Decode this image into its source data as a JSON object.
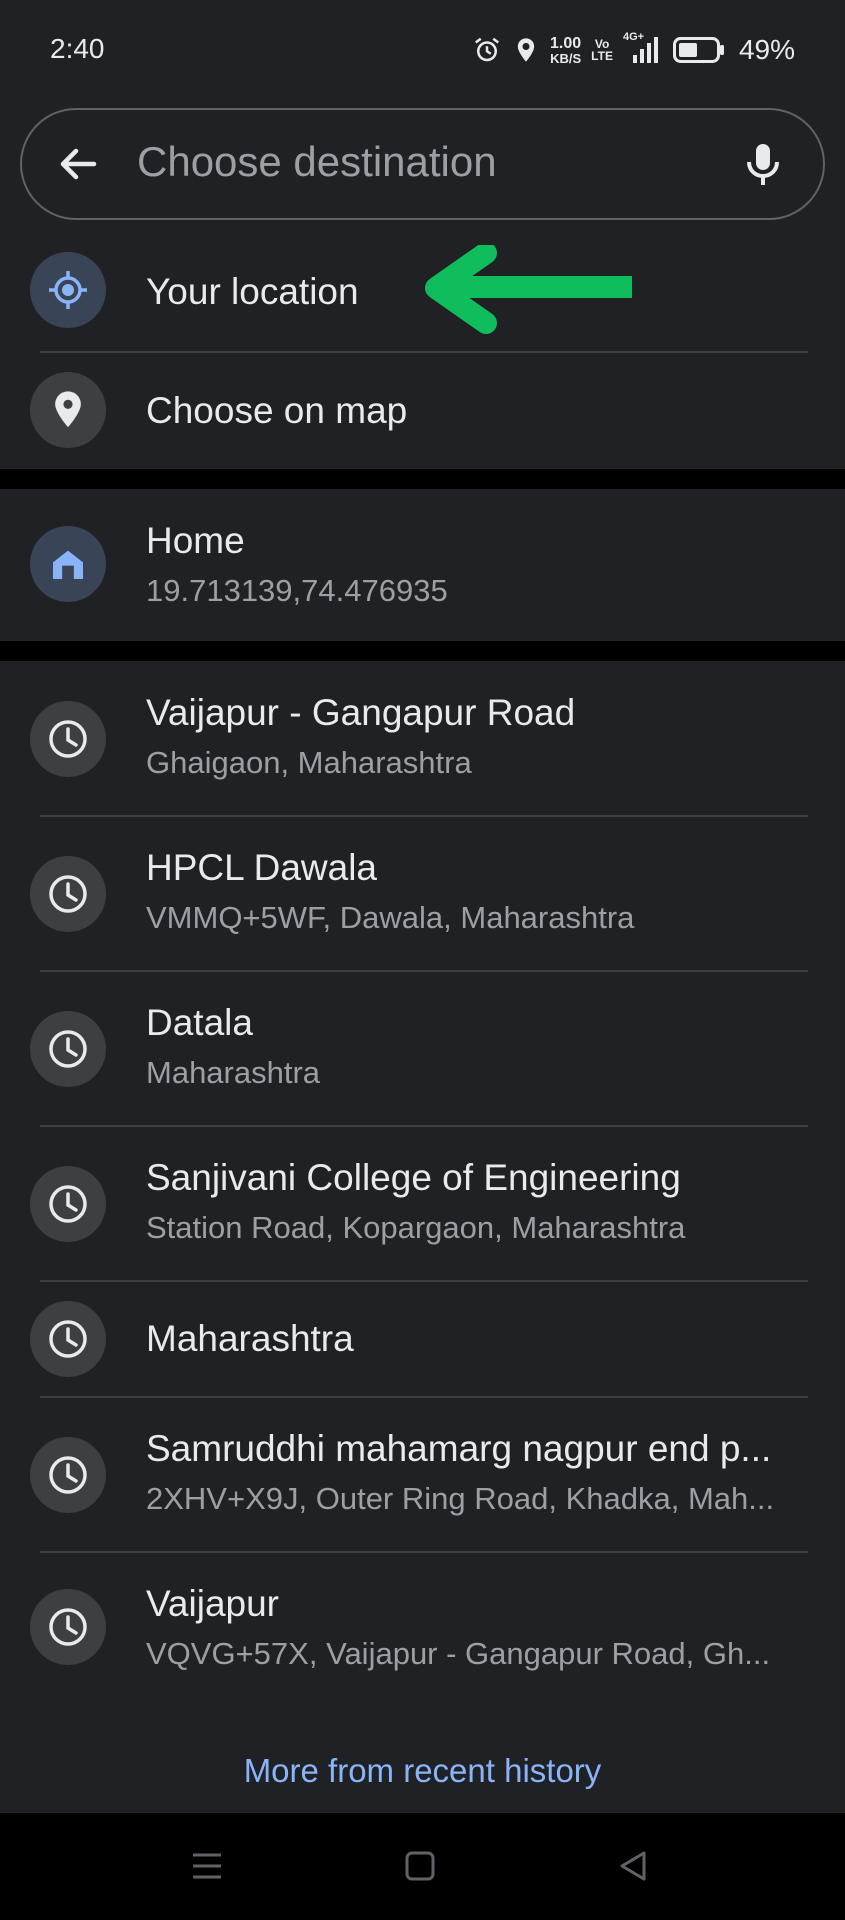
{
  "status_bar": {
    "time": "2:40",
    "net_speed_value": "1.00",
    "net_speed_unit": "KB/S",
    "volte_top": "Vo",
    "volte_bottom": "LTE",
    "network": "4G+",
    "battery": "49%",
    "icons": [
      "alarm-icon",
      "location-icon",
      "signal-icon",
      "battery-icon"
    ]
  },
  "search": {
    "placeholder": "Choose destination",
    "back_icon": "arrow-left-icon",
    "mic_icon": "microphone-icon"
  },
  "quick_options": [
    {
      "label": "Your location",
      "icon": "my-location-icon"
    },
    {
      "label": "Choose on map",
      "icon": "map-pin-icon"
    }
  ],
  "annotation": {
    "arrow_color": "#0fbd5c",
    "direction": "left"
  },
  "saved": {
    "home": {
      "label": "Home",
      "value": "19.713139,74.476935",
      "icon": "home-icon"
    }
  },
  "history": [
    {
      "title": "Vaijapur - Gangapur Road",
      "subtitle": "Ghaigaon, Maharashtra"
    },
    {
      "title": "HPCL Dawala",
      "subtitle": "VMMQ+5WF, Dawala, Maharashtra"
    },
    {
      "title": "Datala",
      "subtitle": "Maharashtra"
    },
    {
      "title": "Sanjivani College of Engineering",
      "subtitle": "Station Road, Kopargaon, Maharashtra"
    },
    {
      "title": "Maharashtra",
      "subtitle": ""
    },
    {
      "title": "Samruddhi mahamarg nagpur end p...",
      "subtitle": "2XHV+X9J, Outer Ring Road, Khadka, Mah..."
    },
    {
      "title": "Vaijapur",
      "subtitle": "VQVG+57X, Vaijapur - Gangapur Road, Gh..."
    }
  ],
  "more_link": "More from recent history",
  "colors": {
    "background": "#202124",
    "accent_blue": "#8ab4f8",
    "arrow_green": "#0fbd5c"
  },
  "nav": {
    "icons": [
      "menu-icon",
      "home-square-icon",
      "back-triangle-icon"
    ]
  }
}
